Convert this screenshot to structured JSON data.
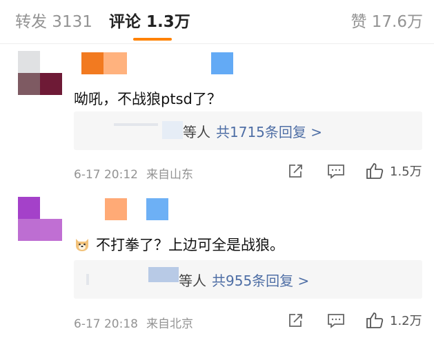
{
  "tabs": {
    "repost_label": "转发 3131",
    "comments_label": "评论 1.3万",
    "likes_label": "赞 17.6万",
    "accent_color": "#ff8200"
  },
  "comments": [
    {
      "text": "呦吼，不战狼ptsd了？",
      "reply_summary": {
        "who": "等人",
        "link": "共1715条回复 >"
      },
      "time": "6-17 20:12",
      "location": "来自山东",
      "like_count": "1.5万"
    },
    {
      "emoji_icon": "doge-icon",
      "text": "不打拳了？上边可全是战狼。",
      "reply_summary": {
        "who": "等人",
        "link": "共955条回复 >"
      },
      "time": "6-17 20:18",
      "location": "来自北京",
      "like_count": "1.2万"
    }
  ],
  "icons": [
    "share-icon",
    "comment-icon",
    "thumbs-up-icon",
    "doge-icon"
  ],
  "colors": {
    "link": "#4e6ea5",
    "meta": "#939393",
    "reply_bg": "#f6f6f6"
  }
}
